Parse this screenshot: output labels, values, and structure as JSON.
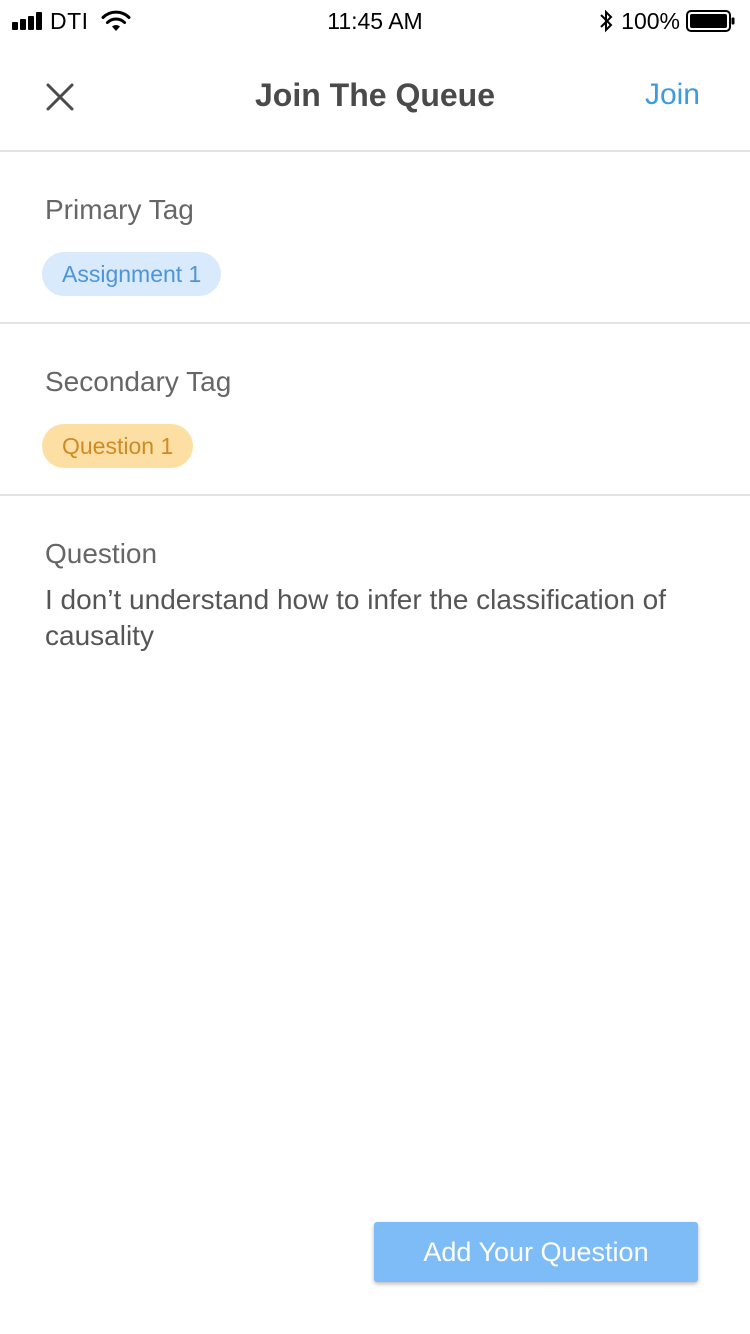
{
  "status_bar": {
    "carrier": "DTI",
    "time": "11:45 AM",
    "battery_percent": "100%",
    "icons": [
      "signal-icon",
      "wifi-icon",
      "bluetooth-icon",
      "battery-icon"
    ]
  },
  "navbar": {
    "close_icon": "close-icon",
    "title": "Join The Queue",
    "join_label": "Join",
    "accent_color": "#3d9be0"
  },
  "primary_tag": {
    "label": "Primary Tag",
    "tag": "Assignment 1",
    "color": "#4d95d8",
    "background": "#d8eafb"
  },
  "secondary_tag": {
    "label": "Secondary Tag",
    "tag": "Question 1",
    "color": "#d08a25",
    "background": "#fddfa3"
  },
  "question": {
    "label": "Question",
    "text": "I don’t understand how to infer the classification of causality"
  },
  "add_question": {
    "label": "Add Your Question",
    "background": "#7dbcf6"
  }
}
